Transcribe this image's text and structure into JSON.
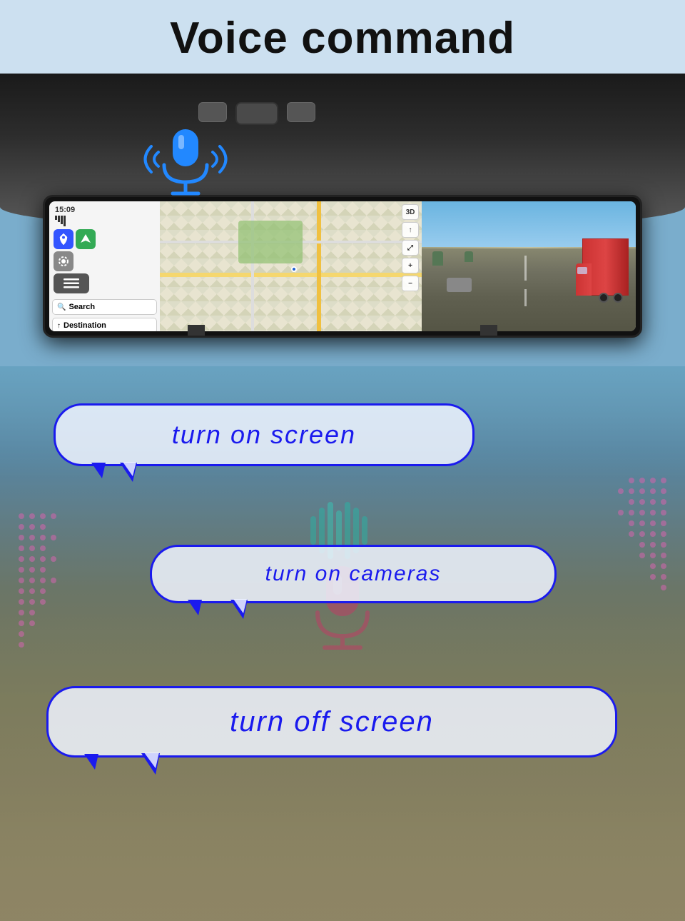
{
  "page": {
    "title": "Voice command",
    "header": {
      "title": "Voice command"
    },
    "mirror": {
      "time": "15:09",
      "search_label": "Search",
      "destination_label": "Destination",
      "map_button_3d": "3D"
    },
    "bubbles": [
      {
        "id": "bubble1",
        "text": "turn on screen"
      },
      {
        "id": "bubble2",
        "text": "turn on cameras"
      },
      {
        "id": "bubble3",
        "text": "turn off screen"
      }
    ],
    "colors": {
      "bubble_border": "#1a1aee",
      "bubble_text": "#1a1aee",
      "bubble_bg": "rgba(240,245,255,0.85)"
    }
  }
}
